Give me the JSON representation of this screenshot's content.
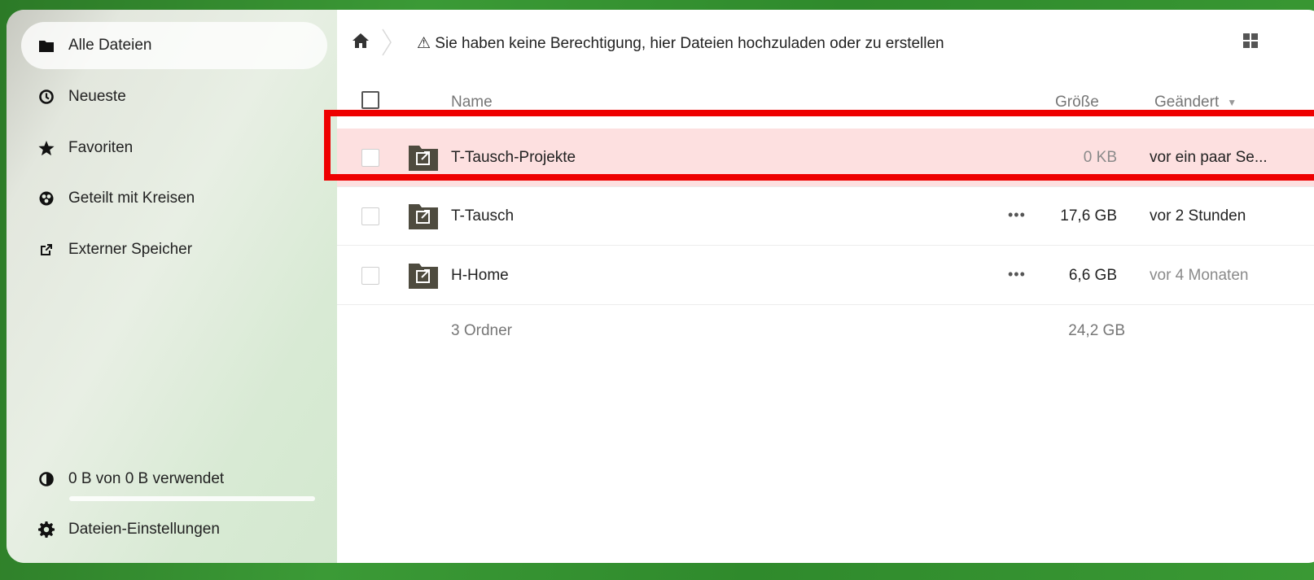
{
  "sidebar": {
    "items": [
      {
        "label": "Alle Dateien",
        "icon": "folder-icon",
        "active": true
      },
      {
        "label": "Neueste",
        "icon": "clock-icon"
      },
      {
        "label": "Favoriten",
        "icon": "star-icon"
      },
      {
        "label": "Geteilt mit Kreisen",
        "icon": "circles-icon"
      },
      {
        "label": "Externer Speicher",
        "icon": "external-link-icon"
      }
    ],
    "quota": {
      "label": "0 B von 0 B verwendet",
      "icon": "pie-chart-icon",
      "used_fraction": 0
    },
    "settings": {
      "label": "Dateien-Einstellungen",
      "icon": "gear-icon"
    }
  },
  "topbar": {
    "home_icon": "home-icon",
    "warning": "⚠ Sie haben keine Berechtigung, hier Dateien hochzuladen oder zu erstellen",
    "view_icon": "grid-view-icon"
  },
  "table": {
    "headers": {
      "name": "Name",
      "size": "Größe",
      "modified": "Geändert"
    },
    "rows": [
      {
        "name": "T-Tausch-Projekte",
        "size": "0 KB",
        "modified": "vor ein paar Se...",
        "icon": "external-folder-icon",
        "highlighted": true
      },
      {
        "name": "T-Tausch",
        "size": "17,6 GB",
        "modified": "vor 2 Stunden",
        "icon": "external-folder-icon",
        "actions": "•••"
      },
      {
        "name": "H-Home",
        "size": "6,6 GB",
        "modified": "vor 4 Monaten",
        "icon": "external-folder-icon",
        "actions": "•••"
      }
    ],
    "summary": {
      "count": "3 Ordner",
      "total": "24,2 GB"
    }
  },
  "colors": {
    "highlight_row": "#fde0e0",
    "annotation_box": "#ee0000",
    "accent": "#3a7f36"
  }
}
